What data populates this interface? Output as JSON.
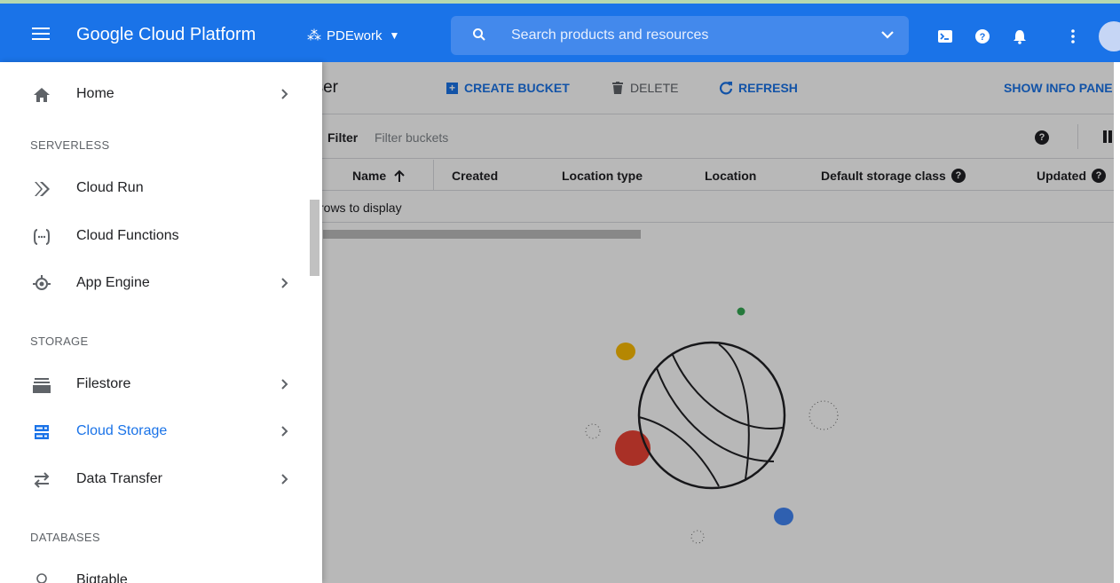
{
  "topbar": {
    "title": "Google Cloud Platform",
    "project": "PDEwork",
    "search_placeholder": "Search products and resources"
  },
  "toolbar": {
    "page_title": "rowser",
    "create_bucket": "CREATE BUCKET",
    "delete": "DELETE",
    "refresh": "REFRESH",
    "show_info_panel": "SHOW INFO PANE"
  },
  "filter": {
    "label": "Filter",
    "placeholder": "Filter buckets"
  },
  "table": {
    "columns": [
      "Name",
      "Created",
      "Location type",
      "Location",
      "Default storage class",
      "Updated"
    ],
    "empty_text": "rows to display"
  },
  "sidebar": {
    "home": "Home",
    "sections": {
      "serverless": "SERVERLESS",
      "storage": "STORAGE",
      "databases": "DATABASES"
    },
    "items": {
      "cloud_run": "Cloud Run",
      "cloud_functions": "Cloud Functions",
      "app_engine": "App Engine",
      "filestore": "Filestore",
      "cloud_storage": "Cloud Storage",
      "data_transfer": "Data Transfer",
      "bigtable": "Bigtable"
    }
  },
  "colors": {
    "brand_blue": "#1a73e8",
    "dot_green": "#34a853",
    "dot_yellow": "#fbbc04",
    "dot_red": "#ea4335",
    "dot_blue": "#4285f4"
  },
  "icons": [
    "menu-icon",
    "project-dots-icon",
    "search-icon",
    "chevron-down-icon",
    "cloud-shell-icon",
    "help-icon",
    "notifications-icon",
    "more-vert-icon",
    "avatar",
    "home-icon",
    "cloud-run-icon",
    "cloud-functions-icon",
    "app-engine-icon",
    "filestore-icon",
    "cloud-storage-icon",
    "data-transfer-icon",
    "bigtable-icon",
    "chevron-right-icon",
    "arrow-up-icon",
    "trash-icon",
    "refresh-icon",
    "columns-icon"
  ]
}
